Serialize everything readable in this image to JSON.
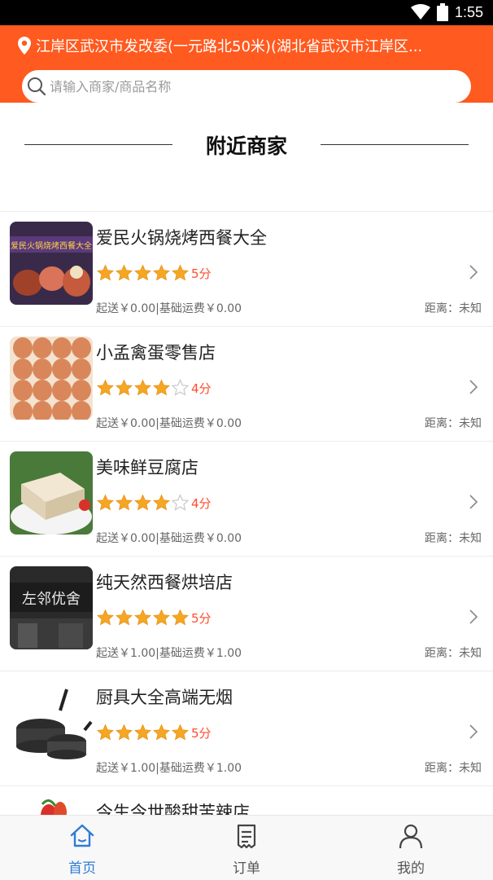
{
  "status_bar": {
    "time": "1:55"
  },
  "header": {
    "location": "江岸区武汉市发改委(一元路北50米)(湖北省武汉市江岸区...",
    "search_placeholder": "请输入商家/商品名称"
  },
  "section": {
    "title": "附近商家"
  },
  "colors": {
    "accent": "#ff5a1f",
    "star": "#f5a623",
    "score": "#ff4d2e",
    "tab_active": "#2e7bd6"
  },
  "merchants": [
    {
      "name": "爱民火锅烧烤西餐大全",
      "rating": 5,
      "score_label": "5分",
      "fee": "起送￥0.00|基础运费￥0.00",
      "distance": "距离：未知",
      "thumb_text": "爱民火锅烧烤西餐大全"
    },
    {
      "name": "小孟禽蛋零售店",
      "rating": 4,
      "score_label": "4分",
      "fee": "起送￥0.00|基础运费￥0.00",
      "distance": "距离：未知"
    },
    {
      "name": "美味鲜豆腐店",
      "rating": 4,
      "score_label": "4分",
      "fee": "起送￥0.00|基础运费￥0.00",
      "distance": "距离：未知"
    },
    {
      "name": "纯天然西餐烘培店",
      "rating": 5,
      "score_label": "5分",
      "fee": "起送￥1.00|基础运费￥1.00",
      "distance": "距离：未知",
      "thumb_text": "左邻优舍"
    },
    {
      "name": "厨具大全高端无烟",
      "rating": 5,
      "score_label": "5分",
      "fee": "起送￥1.00|基础运费￥1.00",
      "distance": "距离：未知"
    },
    {
      "name": "今生今世酸甜苦辣店"
    }
  ],
  "tabbar": [
    {
      "label": "首页",
      "icon": "home-icon",
      "active": true
    },
    {
      "label": "订单",
      "icon": "order-icon",
      "active": false
    },
    {
      "label": "我的",
      "icon": "profile-icon",
      "active": false
    }
  ]
}
